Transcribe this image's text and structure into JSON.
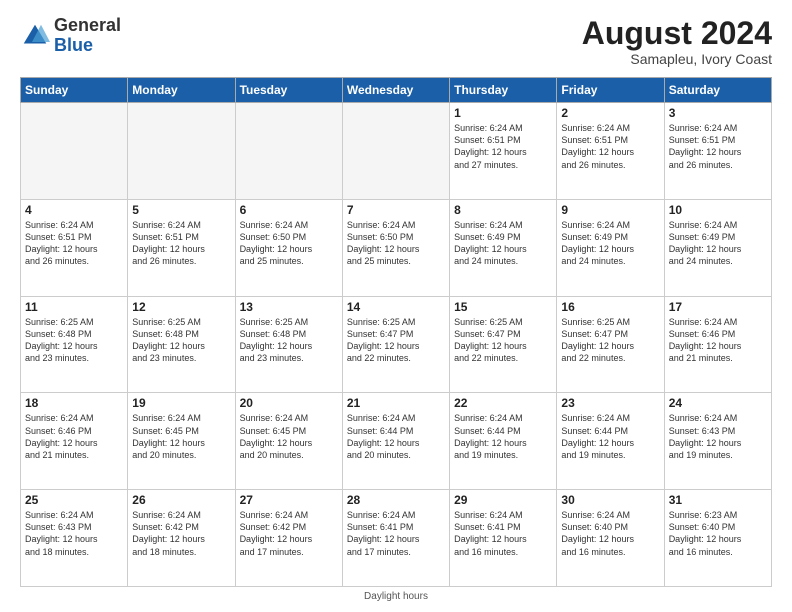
{
  "logo": {
    "general": "General",
    "blue": "Blue"
  },
  "title": {
    "month_year": "August 2024",
    "location": "Samapleu, Ivory Coast"
  },
  "headers": [
    "Sunday",
    "Monday",
    "Tuesday",
    "Wednesday",
    "Thursday",
    "Friday",
    "Saturday"
  ],
  "footer": {
    "daylight_label": "Daylight hours"
  },
  "weeks": [
    [
      {
        "day": "",
        "info": ""
      },
      {
        "day": "",
        "info": ""
      },
      {
        "day": "",
        "info": ""
      },
      {
        "day": "",
        "info": ""
      },
      {
        "day": "1",
        "info": "Sunrise: 6:24 AM\nSunset: 6:51 PM\nDaylight: 12 hours\nand 27 minutes."
      },
      {
        "day": "2",
        "info": "Sunrise: 6:24 AM\nSunset: 6:51 PM\nDaylight: 12 hours\nand 26 minutes."
      },
      {
        "day": "3",
        "info": "Sunrise: 6:24 AM\nSunset: 6:51 PM\nDaylight: 12 hours\nand 26 minutes."
      }
    ],
    [
      {
        "day": "4",
        "info": "Sunrise: 6:24 AM\nSunset: 6:51 PM\nDaylight: 12 hours\nand 26 minutes."
      },
      {
        "day": "5",
        "info": "Sunrise: 6:24 AM\nSunset: 6:51 PM\nDaylight: 12 hours\nand 26 minutes."
      },
      {
        "day": "6",
        "info": "Sunrise: 6:24 AM\nSunset: 6:50 PM\nDaylight: 12 hours\nand 25 minutes."
      },
      {
        "day": "7",
        "info": "Sunrise: 6:24 AM\nSunset: 6:50 PM\nDaylight: 12 hours\nand 25 minutes."
      },
      {
        "day": "8",
        "info": "Sunrise: 6:24 AM\nSunset: 6:49 PM\nDaylight: 12 hours\nand 24 minutes."
      },
      {
        "day": "9",
        "info": "Sunrise: 6:24 AM\nSunset: 6:49 PM\nDaylight: 12 hours\nand 24 minutes."
      },
      {
        "day": "10",
        "info": "Sunrise: 6:24 AM\nSunset: 6:49 PM\nDaylight: 12 hours\nand 24 minutes."
      }
    ],
    [
      {
        "day": "11",
        "info": "Sunrise: 6:25 AM\nSunset: 6:48 PM\nDaylight: 12 hours\nand 23 minutes."
      },
      {
        "day": "12",
        "info": "Sunrise: 6:25 AM\nSunset: 6:48 PM\nDaylight: 12 hours\nand 23 minutes."
      },
      {
        "day": "13",
        "info": "Sunrise: 6:25 AM\nSunset: 6:48 PM\nDaylight: 12 hours\nand 23 minutes."
      },
      {
        "day": "14",
        "info": "Sunrise: 6:25 AM\nSunset: 6:47 PM\nDaylight: 12 hours\nand 22 minutes."
      },
      {
        "day": "15",
        "info": "Sunrise: 6:25 AM\nSunset: 6:47 PM\nDaylight: 12 hours\nand 22 minutes."
      },
      {
        "day": "16",
        "info": "Sunrise: 6:25 AM\nSunset: 6:47 PM\nDaylight: 12 hours\nand 22 minutes."
      },
      {
        "day": "17",
        "info": "Sunrise: 6:24 AM\nSunset: 6:46 PM\nDaylight: 12 hours\nand 21 minutes."
      }
    ],
    [
      {
        "day": "18",
        "info": "Sunrise: 6:24 AM\nSunset: 6:46 PM\nDaylight: 12 hours\nand 21 minutes."
      },
      {
        "day": "19",
        "info": "Sunrise: 6:24 AM\nSunset: 6:45 PM\nDaylight: 12 hours\nand 20 minutes."
      },
      {
        "day": "20",
        "info": "Sunrise: 6:24 AM\nSunset: 6:45 PM\nDaylight: 12 hours\nand 20 minutes."
      },
      {
        "day": "21",
        "info": "Sunrise: 6:24 AM\nSunset: 6:44 PM\nDaylight: 12 hours\nand 20 minutes."
      },
      {
        "day": "22",
        "info": "Sunrise: 6:24 AM\nSunset: 6:44 PM\nDaylight: 12 hours\nand 19 minutes."
      },
      {
        "day": "23",
        "info": "Sunrise: 6:24 AM\nSunset: 6:44 PM\nDaylight: 12 hours\nand 19 minutes."
      },
      {
        "day": "24",
        "info": "Sunrise: 6:24 AM\nSunset: 6:43 PM\nDaylight: 12 hours\nand 19 minutes."
      }
    ],
    [
      {
        "day": "25",
        "info": "Sunrise: 6:24 AM\nSunset: 6:43 PM\nDaylight: 12 hours\nand 18 minutes."
      },
      {
        "day": "26",
        "info": "Sunrise: 6:24 AM\nSunset: 6:42 PM\nDaylight: 12 hours\nand 18 minutes."
      },
      {
        "day": "27",
        "info": "Sunrise: 6:24 AM\nSunset: 6:42 PM\nDaylight: 12 hours\nand 17 minutes."
      },
      {
        "day": "28",
        "info": "Sunrise: 6:24 AM\nSunset: 6:41 PM\nDaylight: 12 hours\nand 17 minutes."
      },
      {
        "day": "29",
        "info": "Sunrise: 6:24 AM\nSunset: 6:41 PM\nDaylight: 12 hours\nand 16 minutes."
      },
      {
        "day": "30",
        "info": "Sunrise: 6:24 AM\nSunset: 6:40 PM\nDaylight: 12 hours\nand 16 minutes."
      },
      {
        "day": "31",
        "info": "Sunrise: 6:23 AM\nSunset: 6:40 PM\nDaylight: 12 hours\nand 16 minutes."
      }
    ]
  ]
}
